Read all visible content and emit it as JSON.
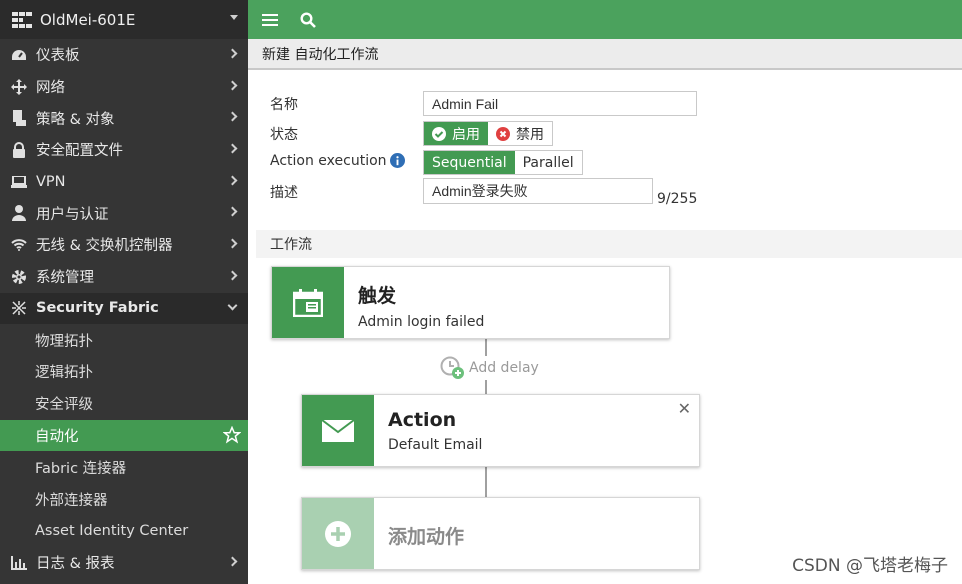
{
  "brand": {
    "title": "OldMei-601E"
  },
  "nav": [
    {
      "label": "仪表板",
      "icon": "dashboard-icon"
    },
    {
      "label": "网络",
      "icon": "arrows-move-icon"
    },
    {
      "label": "策略 & 对象",
      "icon": "policy-icon"
    },
    {
      "label": "安全配置文件",
      "icon": "lock-icon"
    },
    {
      "label": "VPN",
      "icon": "laptop-icon"
    },
    {
      "label": "用户与认证",
      "icon": "user-icon"
    },
    {
      "label": "无线 & 交换机控制器",
      "icon": "wifi-icon"
    },
    {
      "label": "系统管理",
      "icon": "gear-icon"
    },
    {
      "label": "Security Fabric",
      "icon": "fabric-icon"
    }
  ],
  "fabric_sub": [
    {
      "label": "物理拓扑"
    },
    {
      "label": "逻辑拓扑"
    },
    {
      "label": "安全评级"
    },
    {
      "label": "自动化"
    },
    {
      "label": "Fabric 连接器"
    },
    {
      "label": "外部连接器"
    },
    {
      "label": "Asset Identity Center"
    }
  ],
  "nav_last": {
    "label": "日志 & 报表",
    "icon": "chart-icon"
  },
  "page": {
    "title": "新建 自动化工作流"
  },
  "form": {
    "name_label": "名称",
    "name_value": "Admin Fail",
    "status_label": "状态",
    "status_enable": "启用",
    "status_disable": "禁用",
    "exec_label": "Action execution",
    "exec_sequential": "Sequential",
    "exec_parallel": "Parallel",
    "desc_label": "描述",
    "desc_value": "Admin登录失败",
    "desc_counter": "9/255"
  },
  "workflow": {
    "section_title": "工作流",
    "trigger_heading": "触发",
    "trigger_sub": "Admin login failed",
    "add_delay": "Add delay",
    "action_heading": "Action",
    "action_sub": "Default Email",
    "add_action": "添加动作"
  },
  "watermark": "CSDN @飞塔老梅子",
  "colors": {
    "accent": "#439a52",
    "topbar": "#4ba25d",
    "sidebar": "#353535"
  }
}
